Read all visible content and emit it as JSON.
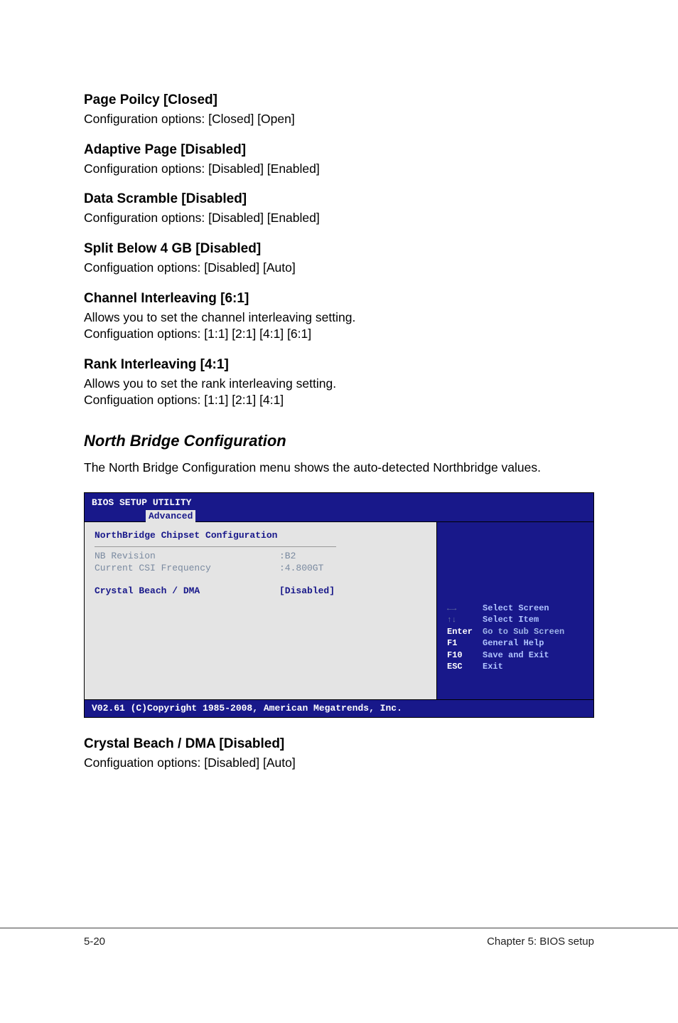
{
  "sections": {
    "page_policy": {
      "title": "Page Poilcy [Closed]",
      "body": "Configuration options: [Closed] [Open]"
    },
    "adaptive_page": {
      "title": "Adaptive Page [Disabled]",
      "body": "Configuration options: [Disabled] [Enabled]"
    },
    "data_scramble": {
      "title": "Data Scramble [Disabled]",
      "body": "Configuration options: [Disabled] [Enabled]"
    },
    "split_below": {
      "title": "Split Below 4 GB [Disabled]",
      "body": "Configuation options: [Disabled] [Auto]"
    },
    "channel_interleaving": {
      "title": "Channel Interleaving [6:1]",
      "body": "Allows you to set the channel interleaving setting.\nConfiguation options: [1:1] [2:1] [4:1] [6:1]"
    },
    "rank_interleaving": {
      "title": "Rank Interleaving [4:1]",
      "body": "Allows you to set the rank interleaving setting.\nConfiguation options: [1:1] [2:1] [4:1]"
    }
  },
  "major": {
    "heading": "North Bridge Configuration",
    "body": "The North Bridge Configuration menu shows the auto-detected Northbridge values."
  },
  "bios": {
    "title": "BIOS SETUP UTILITY",
    "tab": "Advanced",
    "section_label": "NorthBridge Chipset Configuration",
    "rows": {
      "nb_revision": {
        "key": "NB Revision",
        "val": ":B2"
      },
      "csi_freq": {
        "key": "Current CSI Frequency",
        "val": ":4.800GT"
      },
      "crystal": {
        "key": "Crystal Beach / DMA",
        "val": "[Disabled]"
      }
    },
    "help": {
      "select_screen": {
        "k": "←→",
        "v": "Select Screen"
      },
      "select_item": {
        "k": "↑↓",
        "v": " Select Item"
      },
      "enter": {
        "k": "Enter",
        "v": "Go to Sub Screen"
      },
      "f1": {
        "k": "F1",
        "v": "General Help"
      },
      "f10": {
        "k": "F10",
        "v": "Save and Exit"
      },
      "esc": {
        "k": "ESC",
        "v": "Exit"
      }
    },
    "footer": "V02.61 (C)Copyright 1985-2008, American Megatrends, Inc."
  },
  "post_bios": {
    "title": "Crystal Beach / DMA [Disabled]",
    "body": "Configuation options: [Disabled] [Auto]"
  },
  "page_footer": {
    "left": "5-20",
    "right": "Chapter 5: BIOS setup"
  }
}
